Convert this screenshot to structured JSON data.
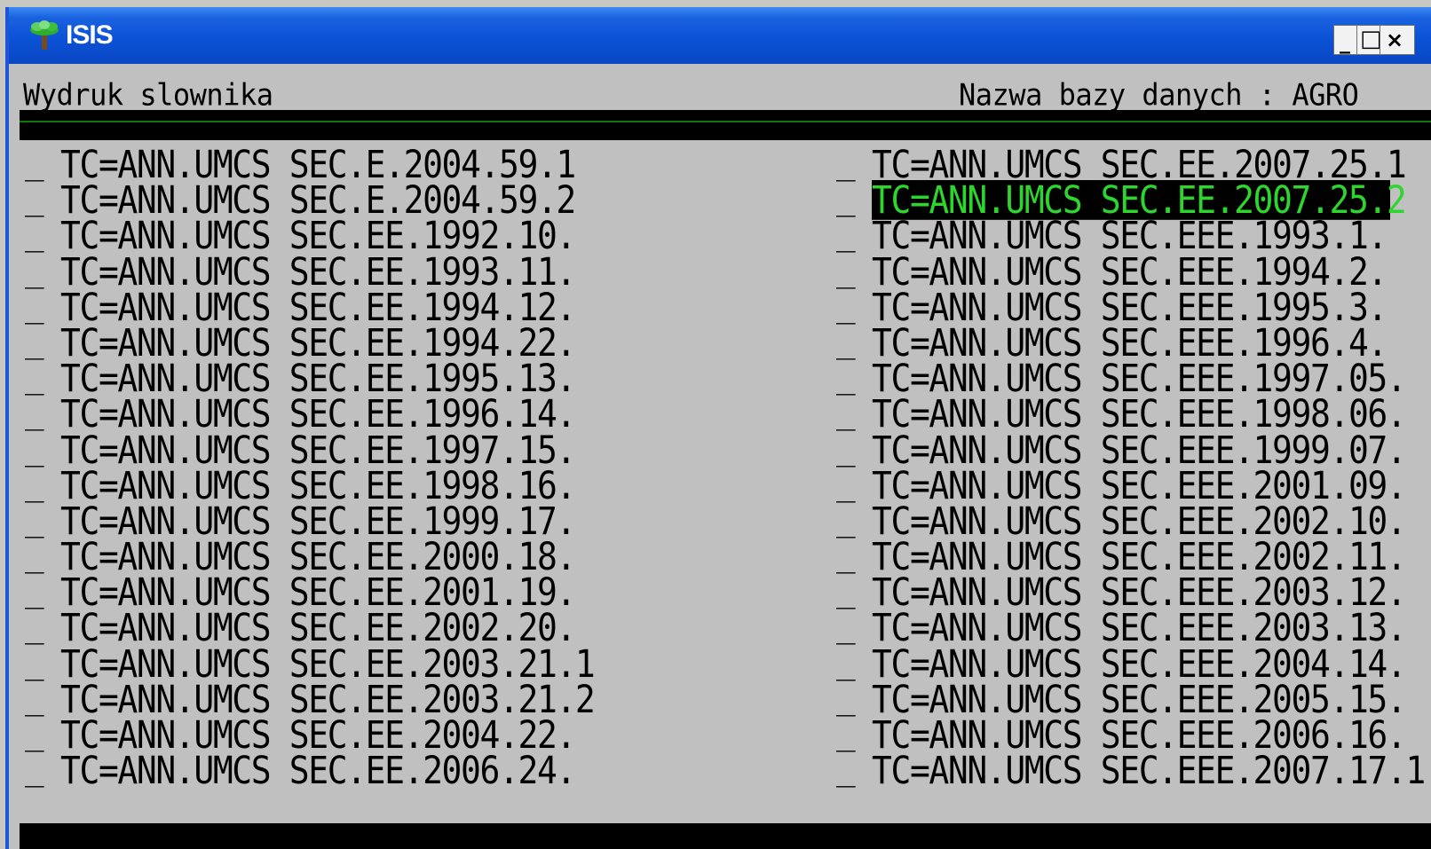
{
  "window": {
    "title": "ISIS",
    "controls": {
      "minimize_glyph": "_",
      "maximize_glyph": "□",
      "close_glyph": "×"
    }
  },
  "console": {
    "header_left": "Wydruk slownika",
    "header_right": "Nazwa bazy danych : AGRO",
    "selection_marker": "_",
    "left_column": [
      "TC=ANN.UMCS SEC.E.2004.59.1",
      "TC=ANN.UMCS SEC.E.2004.59.2",
      "TC=ANN.UMCS SEC.EE.1992.10.",
      "TC=ANN.UMCS SEC.EE.1993.11.",
      "TC=ANN.UMCS SEC.EE.1994.12.",
      "TC=ANN.UMCS SEC.EE.1994.22.",
      "TC=ANN.UMCS SEC.EE.1995.13.",
      "TC=ANN.UMCS SEC.EE.1996.14.",
      "TC=ANN.UMCS SEC.EE.1997.15.",
      "TC=ANN.UMCS SEC.EE.1998.16.",
      "TC=ANN.UMCS SEC.EE.1999.17.",
      "TC=ANN.UMCS SEC.EE.2000.18.",
      "TC=ANN.UMCS SEC.EE.2001.19.",
      "TC=ANN.UMCS SEC.EE.2002.20.",
      "TC=ANN.UMCS SEC.EE.2003.21.1",
      "TC=ANN.UMCS SEC.EE.2003.21.2",
      "TC=ANN.UMCS SEC.EE.2004.22.",
      "TC=ANN.UMCS SEC.EE.2006.24."
    ],
    "right_column": [
      "TC=ANN.UMCS SEC.EE.2007.25.1",
      "TC=ANN.UMCS SEC.EE.2007.25.2",
      "TC=ANN.UMCS SEC.EEE.1993.1.",
      "TC=ANN.UMCS SEC.EEE.1994.2.",
      "TC=ANN.UMCS SEC.EEE.1995.3.",
      "TC=ANN.UMCS SEC.EEE.1996.4.",
      "TC=ANN.UMCS SEC.EEE.1997.05.",
      "TC=ANN.UMCS SEC.EEE.1998.06.",
      "TC=ANN.UMCS SEC.EEE.1999.07.",
      "TC=ANN.UMCS SEC.EEE.2001.09.",
      "TC=ANN.UMCS SEC.EEE.2002.10.",
      "TC=ANN.UMCS SEC.EEE.2002.11.",
      "TC=ANN.UMCS SEC.EEE.2003.12.",
      "TC=ANN.UMCS SEC.EEE.2003.13.",
      "TC=ANN.UMCS SEC.EEE.2004.14.",
      "TC=ANN.UMCS SEC.EEE.2005.15.",
      "TC=ANN.UMCS SEC.EEE.2006.16.",
      "TC=ANN.UMCS SEC.EEE.2007.17.1"
    ],
    "selected": {
      "column": "right",
      "index": 1
    },
    "colors": {
      "background": "#c0c0c0",
      "highlight_background": "#000000",
      "highlight_text": "#2dd62d",
      "titlebar": "#0b52d6"
    }
  }
}
